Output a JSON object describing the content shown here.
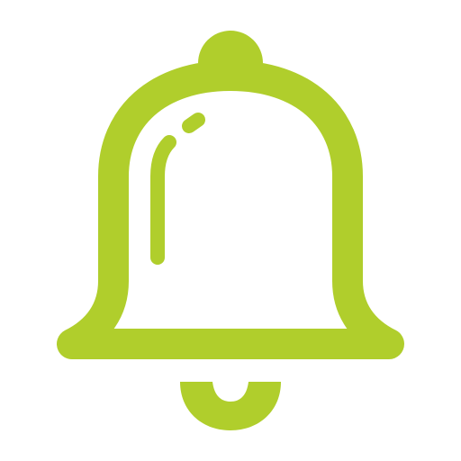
{
  "icon": {
    "name": "bell-icon",
    "color": "#B0CE2C",
    "background": "#FFFFFF"
  }
}
